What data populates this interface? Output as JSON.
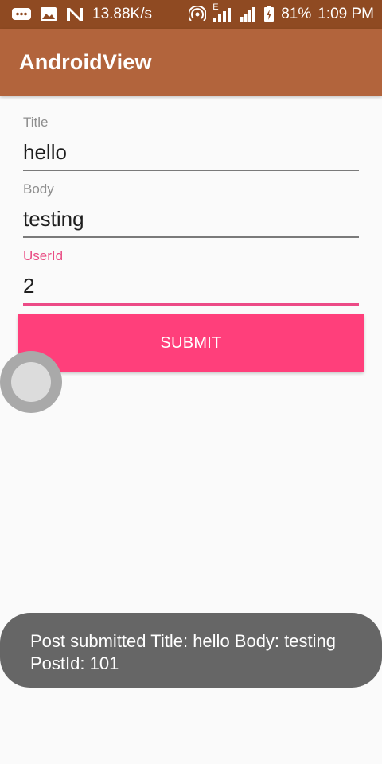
{
  "status_bar": {
    "network_speed": "13.88K/s",
    "network_type": "E",
    "battery": "81%",
    "time": "1:09 PM",
    "icons": [
      "message-icon",
      "gallery-icon",
      "n-icon",
      "hotspot-icon",
      "signal-icon",
      "signal-icon",
      "battery-charging-icon"
    ]
  },
  "app_bar": {
    "title": "AndroidView"
  },
  "form": {
    "title": {
      "label": "Title",
      "value": "hello"
    },
    "body": {
      "label": "Body",
      "value": "testing"
    },
    "user_id": {
      "label": "UserId",
      "value": "2"
    }
  },
  "submit": {
    "label": "SUBMIT"
  },
  "toast": {
    "message": "Post submitted Title: hello Body: testing PostId: 101"
  },
  "colors": {
    "status_bar": "#8f4a22",
    "app_bar": "#b2643c",
    "accent": "#ff3f7b",
    "toast": "#666666"
  }
}
